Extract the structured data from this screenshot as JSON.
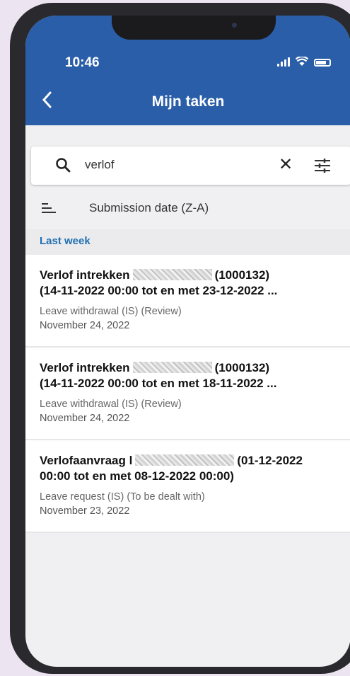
{
  "status_bar": {
    "time": "10:46"
  },
  "header": {
    "back_icon": "chevron-left-icon",
    "title": "Mijn taken"
  },
  "search": {
    "query": "verlof",
    "search_icon": "search-icon",
    "clear_icon": "close-icon",
    "filter_icon": "filter-sliders-icon"
  },
  "sort": {
    "label": "Submission date (Z-A)",
    "icon": "sort-icon"
  },
  "groups": [
    {
      "label": "Last week",
      "items": [
        {
          "title_prefix": "Verlof intrekken",
          "title_suffix": "(1000132)",
          "title_line2": "(14-11-2022 00:00 tot en met 23-12-2022 ...",
          "type": "Leave withdrawal (IS) (Review)",
          "date": "November 24, 2022"
        },
        {
          "title_prefix": "Verlof intrekken",
          "title_suffix": "(1000132)",
          "title_line2": "(14-11-2022 00:00 tot en met 18-11-2022 ...",
          "type": "Leave withdrawal (IS) (Review)",
          "date": "November 24, 2022"
        },
        {
          "title_prefix": "Verlofaanvraag l",
          "title_suffix": "(01-12-2022",
          "title_line2": "00:00 tot en met 08-12-2022 00:00)",
          "type": "Leave request (IS) (To be dealt with)",
          "date": "November 23, 2022"
        }
      ]
    }
  ]
}
